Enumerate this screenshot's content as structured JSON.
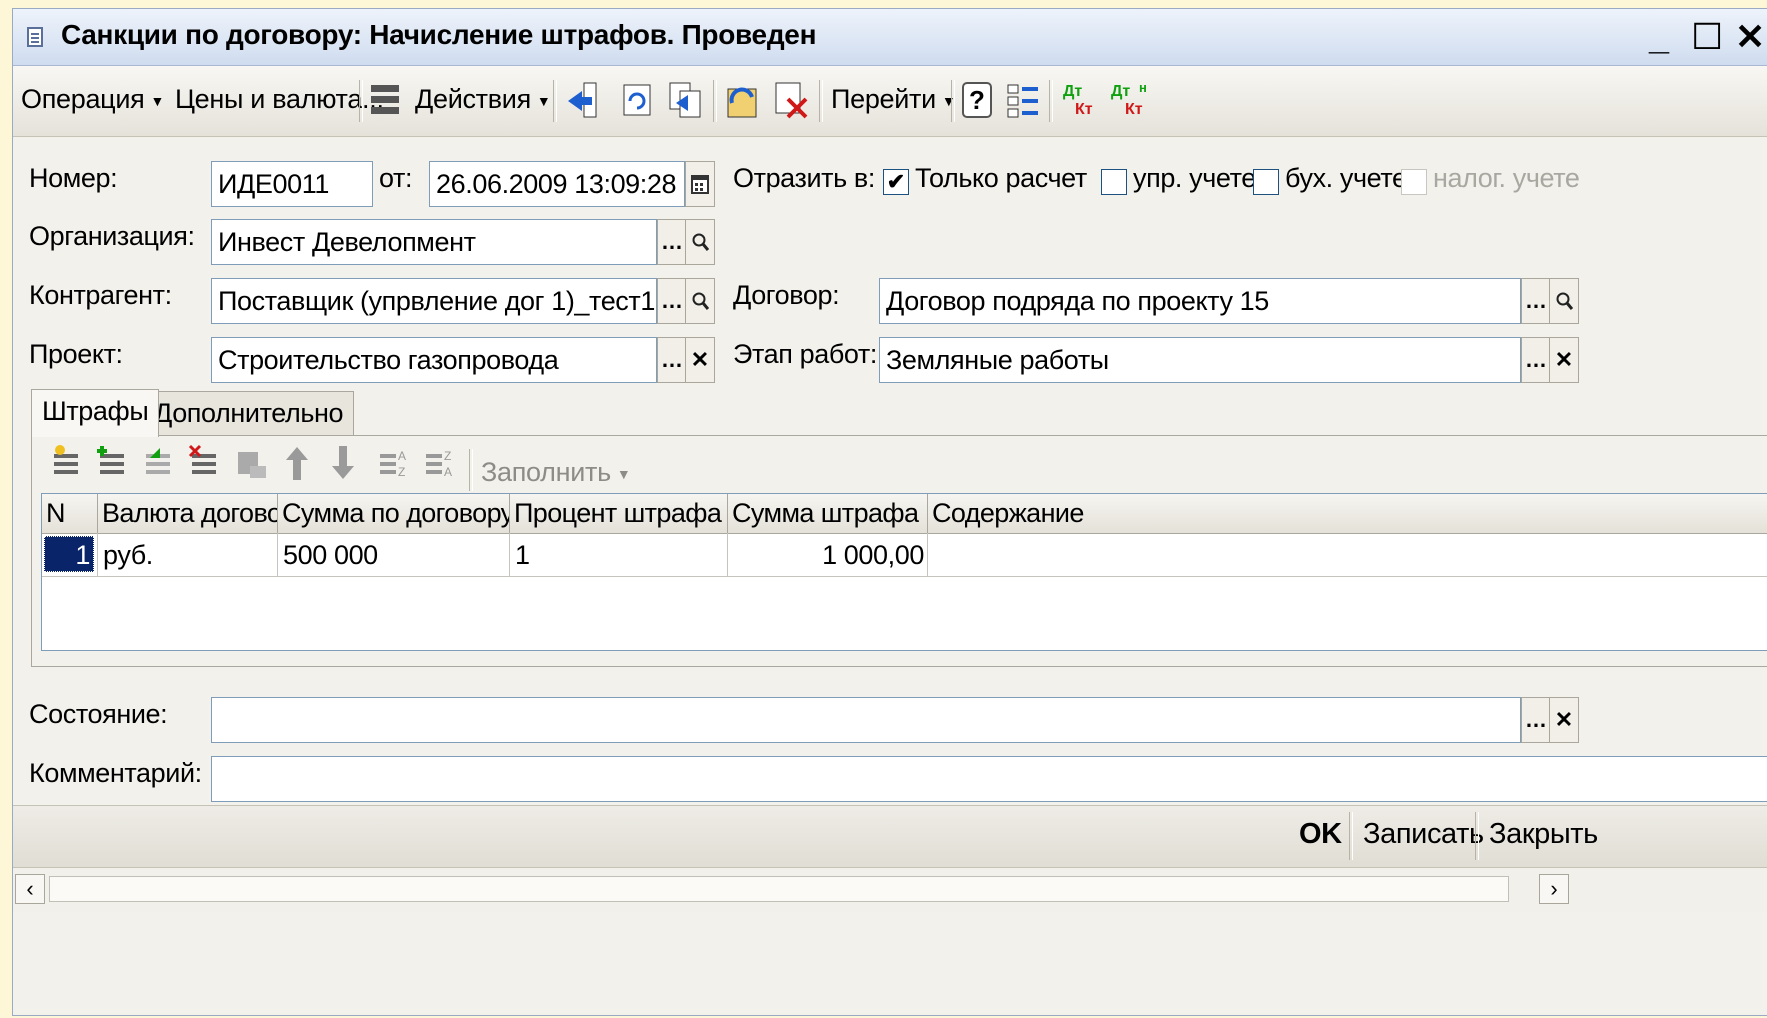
{
  "window": {
    "title": "Санкции по договору: Начисление штрафов. Проведен",
    "minimize": "_",
    "maximize": "☐",
    "close": "✕"
  },
  "toolbar": {
    "operation": "Операция",
    "prices": "Цены и валюта...",
    "actions": "Действия",
    "goto": "Перейти",
    "help": "?",
    "dt_kt": "Дт\nКт",
    "dt_kt_n": "Дт\nКт"
  },
  "form": {
    "number_label": "Номер:",
    "number_value": "ИДЕ0011",
    "date_label": "от:",
    "date_value": "26.06.2009 13:09:28",
    "reflect_label": "Отразить в:",
    "only_calc_label": "Только расчет",
    "only_calc_checked": true,
    "mgmt_label": "упр. учете",
    "acct_label": "бух. учете",
    "tax_label": "налог. учете",
    "org_label": "Организация:",
    "org_value": "Инвест Девелопмент",
    "contractor_label": "Контрагент:",
    "contractor_value": "Поставщик (упрвление дог 1)_тест1",
    "contract_label": "Договор:",
    "contract_value": "Договор подряда по проекту 15",
    "project_label": "Проект:",
    "project_value": "Строительство газопровода",
    "stage_label": "Этап работ:",
    "stage_value": "Земляные работы",
    "state_label": "Состояние:",
    "state_value": "",
    "comment_label": "Комментарий:",
    "comment_value": ""
  },
  "tabs": [
    {
      "label": "Штрафы"
    },
    {
      "label": "Дополнительно"
    }
  ],
  "grid_toolbar": {
    "fill": "Заполнить"
  },
  "table": {
    "columns": [
      "N",
      "Валюта догово...",
      "Сумма по договору",
      "Процент штрафа (%)",
      "Сумма штрафа",
      "Содержание"
    ],
    "rows": [
      [
        "1",
        "руб.",
        "500 000",
        "1",
        "1 000,00",
        ""
      ]
    ]
  },
  "footer": {
    "ok": "OK",
    "save": "Записать",
    "close": "Закрыть"
  },
  "colors": {
    "title_gradient_top": "#eef3fb",
    "selection": "#0a246a",
    "field_border": "#7f9db9"
  }
}
